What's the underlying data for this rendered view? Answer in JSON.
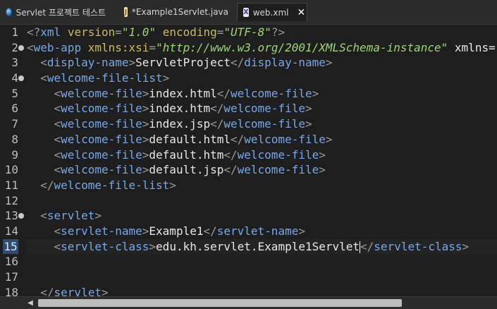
{
  "tabs": [
    {
      "label": "Servlet 프로젝트 테스트",
      "icon": "globe-icon"
    },
    {
      "label": "*Example1Servlet.java",
      "icon": "java-file-icon"
    },
    {
      "label": "web.xml",
      "icon": "xml-file-icon",
      "active": true
    }
  ],
  "editor": {
    "lines": [
      {
        "num": "1",
        "fold": false,
        "text": "<?xml version=\"1.0\" encoding=\"UTF-8\"?>"
      },
      {
        "num": "2",
        "fold": true,
        "text": "<web-app xmlns:xsi=\"http://www.w3.org/2001/XMLSchema-instance\" xmlns=\"http"
      },
      {
        "num": "3",
        "fold": false,
        "text": "  <display-name>ServletProject</display-name>"
      },
      {
        "num": "4",
        "fold": true,
        "text": "  <welcome-file-list>"
      },
      {
        "num": "5",
        "fold": false,
        "text": "    <welcome-file>index.html</welcome-file>"
      },
      {
        "num": "6",
        "fold": false,
        "text": "    <welcome-file>index.htm</welcome-file>"
      },
      {
        "num": "7",
        "fold": false,
        "text": "    <welcome-file>index.jsp</welcome-file>"
      },
      {
        "num": "8",
        "fold": false,
        "text": "    <welcome-file>default.html</welcome-file>"
      },
      {
        "num": "9",
        "fold": false,
        "text": "    <welcome-file>default.htm</welcome-file>"
      },
      {
        "num": "10",
        "fold": false,
        "text": "    <welcome-file>default.jsp</welcome-file>"
      },
      {
        "num": "11",
        "fold": false,
        "text": "  </welcome-file-list>"
      },
      {
        "num": "12",
        "fold": false,
        "text": ""
      },
      {
        "num": "13",
        "fold": true,
        "text": "  <servlet>"
      },
      {
        "num": "14",
        "fold": false,
        "text": "    <servlet-name>Example1</servlet-name>"
      },
      {
        "num": "15",
        "fold": false,
        "current": true,
        "text": "    <servlet-class>edu.kh.servlet.Example1Servlet</servlet-class>"
      },
      {
        "num": "16",
        "fold": false,
        "text": ""
      },
      {
        "num": "17",
        "fold": false,
        "text": ""
      },
      {
        "num": "18",
        "fold": false,
        "text": "  </servlet>"
      }
    ]
  },
  "colors": {
    "tag": "#7aa7e6",
    "attribute": "#c9b86a",
    "value": "#9fd37a",
    "text": "#e8e8e8",
    "bracket": "#9a9a9a"
  }
}
